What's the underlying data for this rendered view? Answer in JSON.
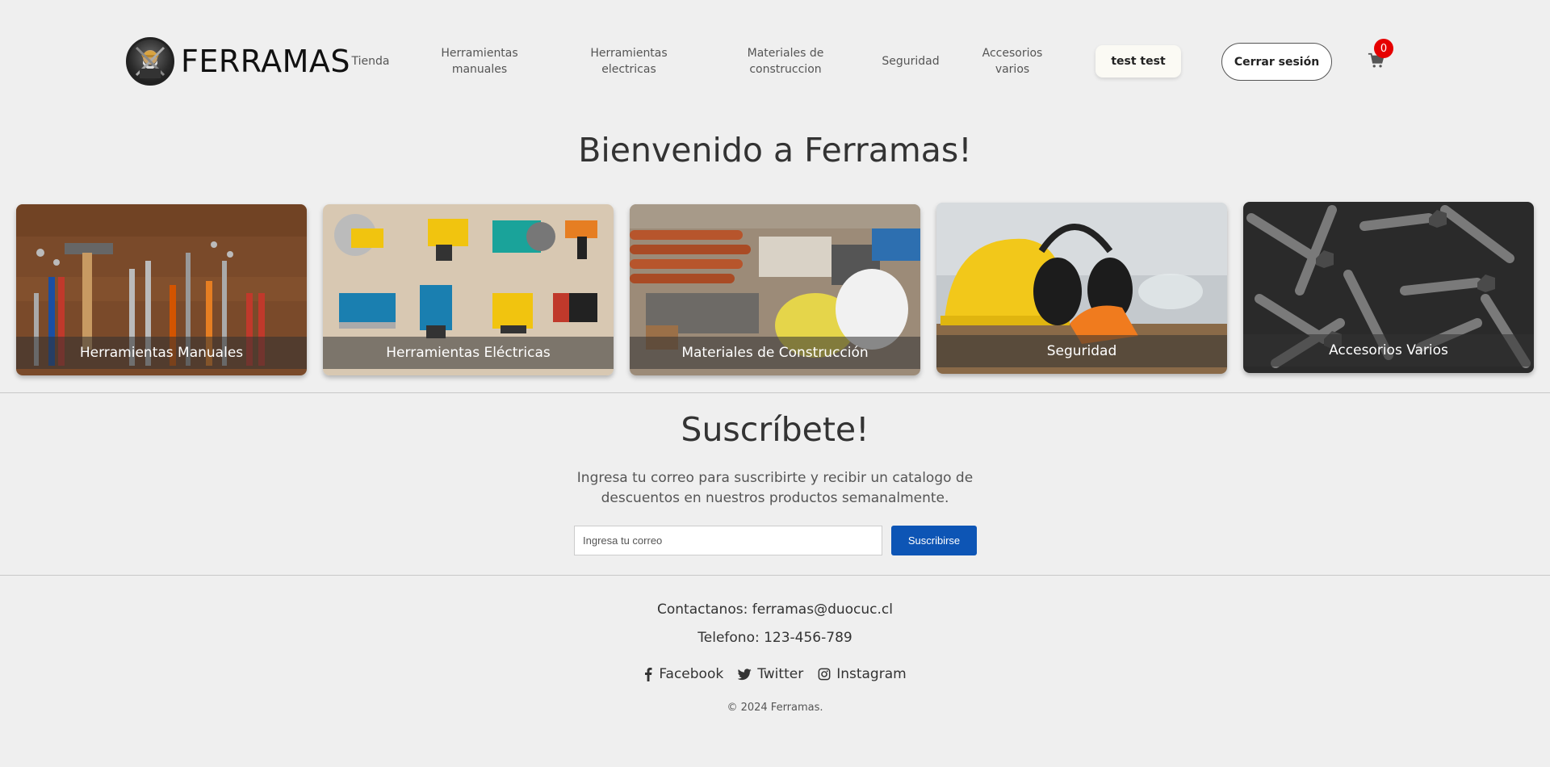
{
  "header": {
    "logo_text": "FERRAMAS",
    "nav": [
      {
        "label": "Tienda"
      },
      {
        "label": "Herramientas manuales"
      },
      {
        "label": "Herramientas electricas"
      },
      {
        "label": "Materiales de construccion"
      },
      {
        "label": "Seguridad"
      },
      {
        "label": "Accesorios varios"
      }
    ],
    "user_label": "test test",
    "logout_label": "Cerrar sesión",
    "cart_count": "0",
    "cart_icon": "shopping-cart-icon",
    "badge_color": "#e60000"
  },
  "main": {
    "welcome_title": "Bienvenido a Ferramas!",
    "categories": [
      {
        "label": "Herramientas Manuales"
      },
      {
        "label": "Herramientas Eléctricas"
      },
      {
        "label": "Materiales de Construcción"
      },
      {
        "label": "Seguridad"
      },
      {
        "label": "Accesorios Varios"
      }
    ]
  },
  "subscribe": {
    "title": "Suscríbete!",
    "text": "Ingresa tu correo para suscribirte y recibir un catalogo de descuentos en nuestros productos semanalmente.",
    "input_placeholder": "Ingresa tu correo",
    "input_value": "",
    "button_label": "Suscribirse",
    "button_color": "#0d55b5"
  },
  "footer": {
    "contact": "Contactanos: ferramas@duocuc.cl",
    "phone": "Telefono: 123-456-789",
    "social": [
      {
        "label": "Facebook",
        "icon": "facebook-icon"
      },
      {
        "label": "Twitter",
        "icon": "twitter-icon"
      },
      {
        "label": "Instagram",
        "icon": "instagram-icon"
      }
    ],
    "copyright": "© 2024 Ferramas."
  }
}
